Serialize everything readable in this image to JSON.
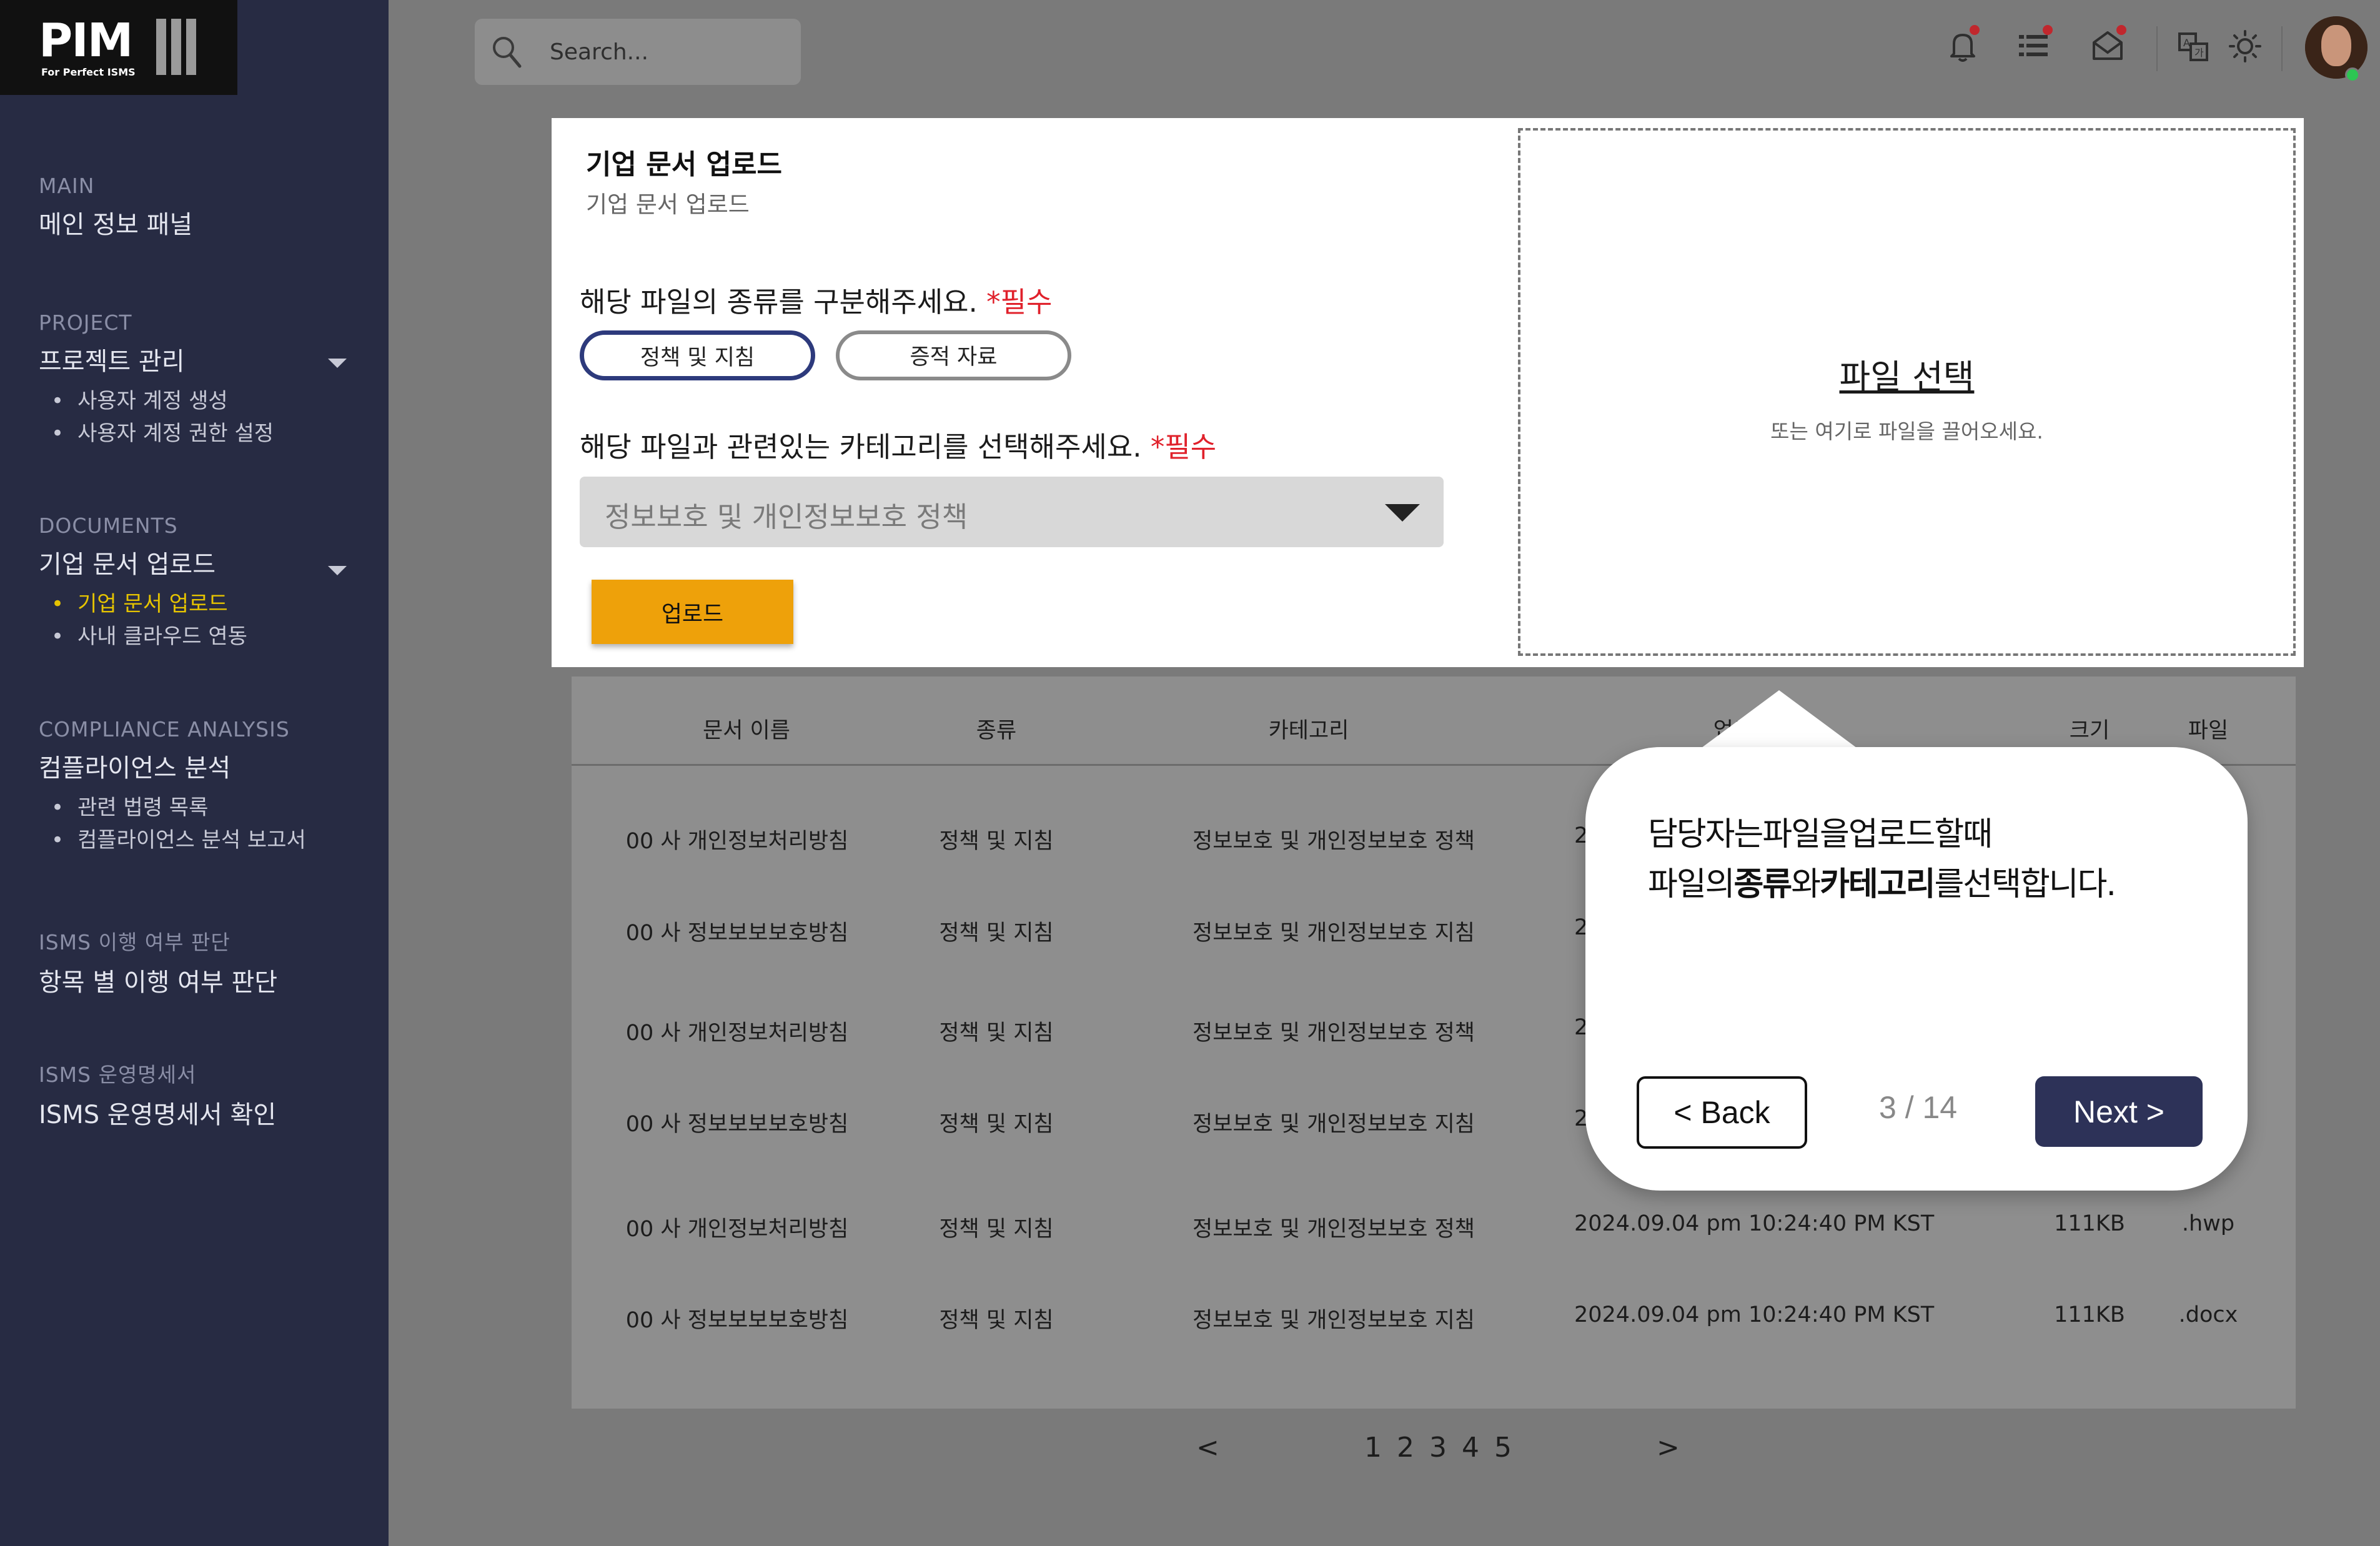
{
  "logo": {
    "name": "PIM",
    "tagline": "For Perfect ISMS"
  },
  "sidebar": {
    "groups": [
      {
        "category": "MAIN",
        "title": "메인 정보 패널",
        "items": []
      },
      {
        "category": "PROJECT",
        "title": "프로젝트 관리",
        "items": [
          "사용자 계정 생성",
          "사용자 계정 권한 설정"
        ]
      },
      {
        "category": "DOCUMENTS",
        "title": "기업 문서 업로드",
        "items": [
          "기업 문서 업로드",
          "사내 클라우드 연동"
        ],
        "active_item": "기업 문서 업로드"
      },
      {
        "category": "COMPLIANCE ANALYSIS",
        "title": "컴플라이언스 분석",
        "items": [
          "관련 법령 목록",
          "컴플라이언스 분석 보고서"
        ]
      },
      {
        "category": "ISMS 이행 여부 판단",
        "title": "항목 별 이행 여부 판단",
        "items": []
      },
      {
        "category": "ISMS 운영명세서",
        "title": "ISMS 운영명세서 확인",
        "items": []
      }
    ]
  },
  "header": {
    "search_placeholder": "Search...",
    "icons": [
      "bell-icon",
      "list-icon",
      "mail-icon",
      "translate-icon",
      "sun-icon"
    ],
    "notification_dot_color": "#c1272d"
  },
  "upload": {
    "title": "기업 문서 업로드",
    "subtitle": "기업 문서 업로드",
    "type_question": "해당 파일의 종류를 구분해주세요.",
    "required_mark": "*필수",
    "type_options": [
      "정책 및 지침",
      "증적 자료"
    ],
    "type_selected": "정책 및 지침",
    "category_question": "해당 파일과 관련있는 카테고리를 선택해주세요.",
    "category_selected": "정보보호 및 개인정보보호 정책",
    "upload_label": "업로드",
    "dropzone_link": "파일 선택",
    "dropzone_hint": "또는 여기로 파일을 끌어오세요."
  },
  "table": {
    "headers": [
      "문서 이름",
      "종류",
      "카테고리",
      "업로",
      "크기",
      "파일"
    ],
    "rows": [
      {
        "name": "00 사 개인정보처리방침",
        "type": "정책 및 지침",
        "category": "정보보호 및 개인정보보호 정책",
        "date": "2",
        "size": "",
        "ext": ""
      },
      {
        "name": "00 사 정보보보보호방침",
        "type": "정책 및 지침",
        "category": "정보보호 및 개인정보보호 지침",
        "date": "2",
        "size": "",
        "ext": ""
      },
      {
        "name": "00 사 개인정보처리방침",
        "type": "정책 및 지침",
        "category": "정보보호 및 개인정보보호 정책",
        "date": "2",
        "size": "",
        "ext": ""
      },
      {
        "name": "00 사 정보보보보호방침",
        "type": "정책 및 지침",
        "category": "정보보호 및 개인정보보호 지침",
        "date": "2",
        "size": "",
        "ext": ""
      },
      {
        "name": "00 사 개인정보처리방침",
        "type": "정책 및 지침",
        "category": "정보보호 및 개인정보보호 정책",
        "date": "2024.09.04 pm 10:24:40 PM KST",
        "size": "111KB",
        "ext": ".hwp"
      },
      {
        "name": "00 사 정보보보보호방침",
        "type": "정책 및 지침",
        "category": "정보보호 및 개인정보보호 지침",
        "date": "2024.09.04 pm 10:24:40 PM KST",
        "size": "111KB",
        "ext": ".docx"
      }
    ]
  },
  "pagination": {
    "prev": "<",
    "pages": [
      "1",
      "2",
      "3",
      "4",
      "5"
    ],
    "next": ">"
  },
  "tour": {
    "line1": "담당자는파일을업로드할때",
    "line2_a": "파일의",
    "line2_b": "종류",
    "line2_c": "와",
    "line2_d": "카테고리",
    "line2_e": "를선택합니다.",
    "back_label": "< Back",
    "step": "3 / 14",
    "next_label": "Next >"
  },
  "colors": {
    "sidebar_bg": "#272b43",
    "accent_yellow": "#e5c300",
    "upload_button": "#eea10a",
    "next_button": "#2d3258",
    "required_red": "#e0212b"
  }
}
